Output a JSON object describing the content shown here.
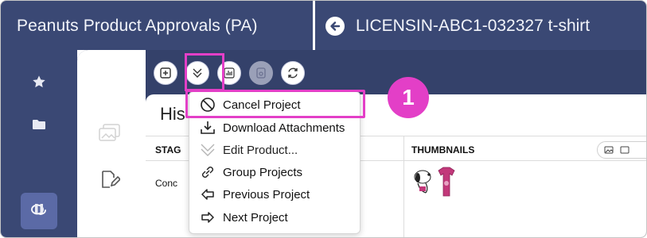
{
  "header": {
    "app_title": "Peanuts Product Approvals (PA)",
    "record_title": "LICENSIN-ABC1-032327 t-shirt"
  },
  "sidebar": {
    "items": [
      {
        "icon": "star-icon"
      },
      {
        "icon": "folder-icon"
      },
      {
        "icon": "chat-icon",
        "active": true
      },
      {
        "icon": "pause-icon"
      }
    ]
  },
  "toolbar": {
    "buttons": [
      {
        "icon": "add-icon"
      },
      {
        "icon": "chevron-down-icon",
        "highlighted": true
      },
      {
        "icon": "bar-chart-icon"
      },
      {
        "icon": "save-icon",
        "disabled": true
      },
      {
        "icon": "refresh-icon"
      }
    ]
  },
  "panel": {
    "heading": "His",
    "columns": {
      "stage": "STAG",
      "thumbnails": "THUMBNAILS"
    },
    "rows": [
      {
        "stage": "Conc"
      }
    ]
  },
  "menu": {
    "items": [
      {
        "label": "Cancel Project",
        "icon": "cancel-icon"
      },
      {
        "label": "Download Attachments",
        "icon": "download-icon"
      },
      {
        "label": "Edit Product...",
        "icon": "chevron-down-icon"
      },
      {
        "label": "Group Projects",
        "icon": "link-icon"
      },
      {
        "label": "Previous Project",
        "icon": "arrow-left-icon"
      },
      {
        "label": "Next Project",
        "icon": "arrow-right-icon"
      }
    ]
  },
  "callout": {
    "step": "1"
  },
  "colors": {
    "nav": "#3a4874",
    "accent": "#e33fc7",
    "shirt": "#c2387a"
  }
}
